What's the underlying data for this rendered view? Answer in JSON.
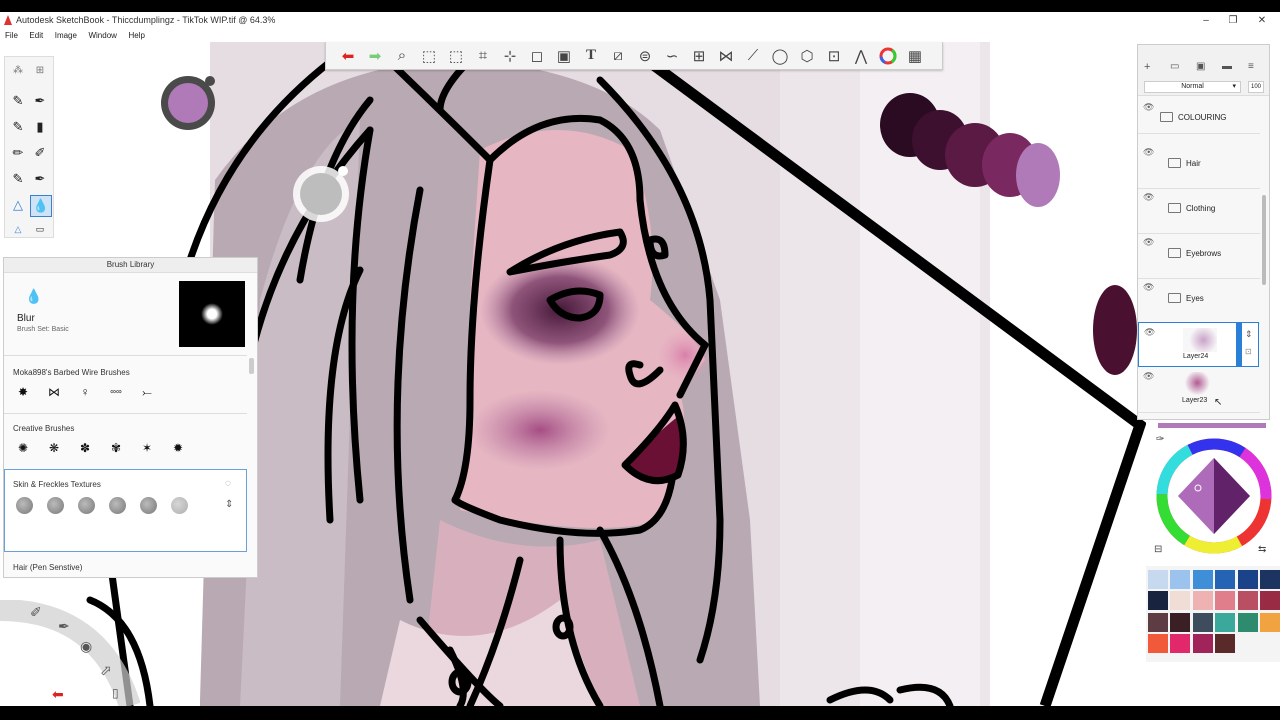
{
  "window": {
    "title": "Autodesk SketchBook - Thiccdumplingz - TikTok WIP.tif @ 64.3%",
    "controls": [
      "–",
      "❐",
      "✕"
    ]
  },
  "menu": [
    "File",
    "Edit",
    "Image",
    "Window",
    "Help"
  ],
  "toolbar": {
    "icons": [
      "undo-icon",
      "redo-icon",
      "zoom-icon",
      "select-icon",
      "lasso-icon",
      "crop-icon",
      "transform-icon",
      "perspective-icon",
      "fill-icon",
      "text-icon",
      "ruler-icon",
      "ellipse-guide-icon",
      "french-curve-icon",
      "symmetry-icon",
      "distort-icon",
      "stroke-icon",
      "shape-icon",
      "predictive-icon",
      "copic-icon",
      "brush-icon",
      "color-wheel-icon",
      "palette-icon"
    ]
  },
  "brush_library": {
    "title": "Brush Library",
    "current_brush": "Blur",
    "brush_set": "Brush Set: Basic",
    "sections": [
      "Moka898's Barbed Wire Brushes",
      "Creative Brushes",
      "Skin & Freckles Textures",
      "Hair (Pen Senstive)"
    ]
  },
  "layers": {
    "blend_mode": "Normal",
    "opacity": "100",
    "group": "COLOURING",
    "items": [
      "Hair",
      "Clothing",
      "Eyebrows",
      "Eyes",
      "Layer24",
      "Layer23"
    ]
  },
  "colors": {
    "puck": "#b07ab8",
    "accent": "#2a7fd6",
    "swatches": [
      "#c7d9ee",
      "#9cc2ee",
      "#3f8ed8",
      "#2563b5",
      "#1a4389",
      "#1d3461",
      "#17233f",
      "#f0ddd6",
      "#efb2b2",
      "#e07e8c",
      "#b94f63",
      "#9a2b45",
      "#5e3c44",
      "#3a2025",
      "#3e4d5e",
      "#3aa89a",
      "#2e8b6d",
      "#f1a342",
      "#f05a3a",
      "#e0286a",
      "#a0245a",
      "#5a2a2a"
    ]
  }
}
